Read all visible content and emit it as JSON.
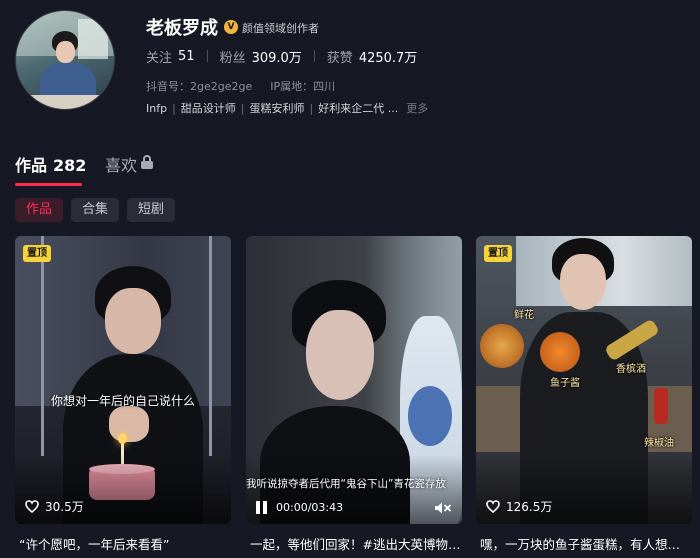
{
  "profile": {
    "name": "老板罗成",
    "verify_badge": "V",
    "verify_text": "颜值领域创作者",
    "stats": [
      {
        "label": "关注",
        "value": "51"
      },
      {
        "label": "粉丝",
        "value": "309.0万"
      },
      {
        "label": "获赞",
        "value": "4250.7万"
      }
    ],
    "douyin_id": "抖音号：2ge2ge2ge",
    "ip_location": "IP属地：四川",
    "tags": [
      "Infp",
      "甜品设计师",
      "蛋糕安利师",
      "好利来企二代 ..."
    ],
    "more_label": "更多"
  },
  "tabs": {
    "works_label": "作品",
    "works_count": "282",
    "likes_label": "喜欢"
  },
  "filters": [
    "作品",
    "合集",
    "短剧"
  ],
  "videos": [
    {
      "pin_label": "置顶",
      "likes": "30.5万",
      "subtitle": "你想对一年后的自己说什么",
      "caption": "“许个愿吧，一年后来看看”"
    },
    {
      "subtitle": "我听说掠夺者后代用“鬼谷下山”青花瓷存放",
      "time": "00:00/03:43",
      "caption": "一起，等他们回家！#逃出大英博物…"
    },
    {
      "pin_label": "置顶",
      "likes": "126.5万",
      "overlay_tags": [
        "鲜花",
        "鱼子酱",
        "香槟酒",
        "辣椒油"
      ],
      "caption": "嘿，一万块的鱼子酱蛋糕，有人想要…"
    }
  ],
  "colors": {
    "background": "#161823",
    "accent": "#fe2c55",
    "pin_badge": "#f7d33a",
    "verify_badge": "#f2b43a"
  }
}
